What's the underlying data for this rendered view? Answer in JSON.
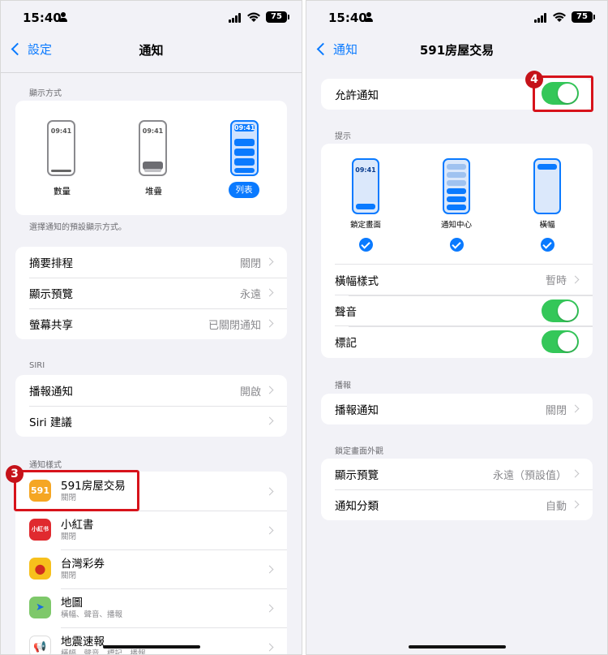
{
  "status": {
    "time": "15:40",
    "battery": "75"
  },
  "left": {
    "back_label": "設定",
    "title": "通知",
    "display_section": {
      "header": "顯示方式",
      "preview_time": "09:41",
      "options": [
        "數量",
        "堆疊",
        "列表"
      ],
      "selected": "列表",
      "footer": "選擇通知的預設顯示方式。"
    },
    "settings_rows": [
      {
        "label": "摘要排程",
        "value": "關閉"
      },
      {
        "label": "顯示預覽",
        "value": "永遠"
      },
      {
        "label": "螢幕共享",
        "value": "已關閉通知"
      }
    ],
    "siri_header": "SIRI",
    "siri_rows": [
      {
        "label": "播報通知",
        "value": "開啟"
      },
      {
        "label": "Siri 建議",
        "value": ""
      }
    ],
    "apps_header": "通知樣式",
    "apps": [
      {
        "name": "591房屋交易",
        "sub": "關閉",
        "icon_text": "591",
        "icon_color": "#f5a623"
      },
      {
        "name": "小紅書",
        "sub": "關閉",
        "icon_text": "小紅书",
        "icon_color": "#e02a2f"
      },
      {
        "name": "台灣彩券",
        "sub": "關閉",
        "icon_text": "●",
        "icon_color": "#f7c01c"
      },
      {
        "name": "地圖",
        "sub": "橫幅、聲音、播報",
        "icon_text": "➤",
        "icon_color": "#5ab0ea"
      },
      {
        "name": "地震速報",
        "sub": "橫幅、聲音、標記、播報",
        "icon_text": "📢",
        "icon_color": "#ffffff"
      }
    ],
    "step_badge": "3"
  },
  "right": {
    "back_label": "通知",
    "title": "591房屋交易",
    "allow_label": "允許通知",
    "allow_on": true,
    "alerts_header": "提示",
    "alerts_time": "09:41",
    "alerts_options": [
      "鎖定畫面",
      "通知中心",
      "橫幅"
    ],
    "banner_style_label": "橫幅樣式",
    "banner_style_value": "暫時",
    "sound_label": "聲音",
    "badge_label": "標記",
    "announce_header": "播報",
    "announce_label": "播報通知",
    "announce_value": "關閉",
    "lock_header": "鎖定畫面外觀",
    "show_preview_label": "顯示預覽",
    "show_preview_value": "永遠（預設值）",
    "grouping_label": "通知分類",
    "grouping_value": "自動",
    "step_badge": "4"
  },
  "colors": {
    "accent": "#0a7aff",
    "toggle_on": "#34c759",
    "highlight": "#d7131b"
  }
}
